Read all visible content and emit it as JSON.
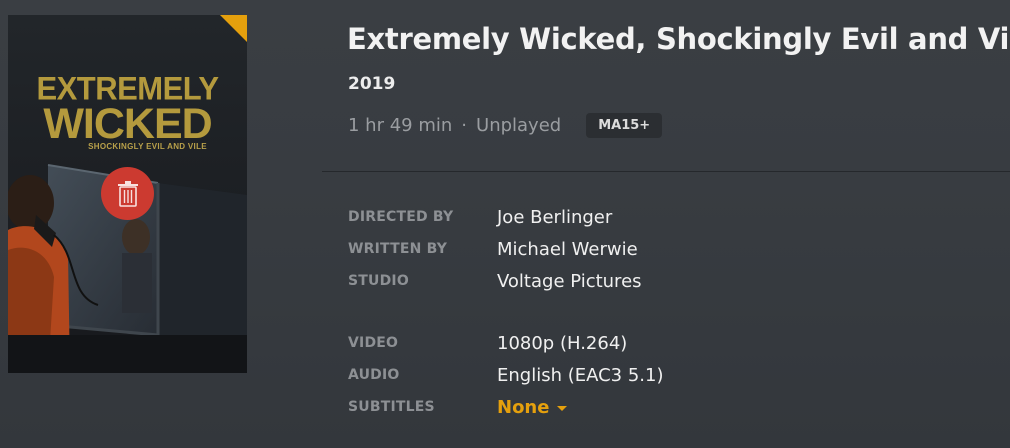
{
  "poster": {
    "title_line1": "EXTREMELY",
    "title_line2": "WICKED",
    "title_line3": "SHOCKINGLY EVIL AND VILE",
    "delete_icon": "trash-icon",
    "corner_color": "#e5a00d"
  },
  "movie": {
    "title": "Extremely Wicked, Shockingly Evil and Vile",
    "year": "2019",
    "duration": "1 hr 49 min",
    "separator": "·",
    "play_status": "Unplayed",
    "rating": "MA15+"
  },
  "details": {
    "directed_by_label": "DIRECTED BY",
    "directed_by": "Joe Berlinger",
    "written_by_label": "WRITTEN BY",
    "written_by": "Michael Werwie",
    "studio_label": "STUDIO",
    "studio": "Voltage Pictures"
  },
  "media": {
    "video_label": "VIDEO",
    "video": "1080p (H.264)",
    "audio_label": "AUDIO",
    "audio": "English (EAC3 5.1)",
    "subtitles_label": "SUBTITLES",
    "subtitles": "None"
  },
  "colors": {
    "accent": "#e5a00d",
    "delete": "#cc3a30",
    "background": "#3a3e43"
  }
}
